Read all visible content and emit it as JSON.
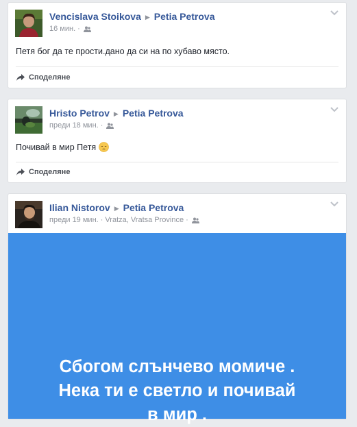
{
  "posts": [
    {
      "author": "Vencislava Stoikova",
      "target": "Petia Petrova",
      "time": "16 мин.",
      "location": "",
      "text": "Петя бог да те прости.дано да си на по хубаво място.",
      "share_label": "Споделяне"
    },
    {
      "author": "Hristo Petrov",
      "target": "Petia Petrova",
      "time": "преди 18 мин.",
      "location": "",
      "text": "Почивай в мир Петя",
      "share_label": "Споделяне"
    },
    {
      "author": "Ilian Nistorov",
      "target": "Petia Petrova",
      "time": "преди 19 мин.",
      "location": "Vratza, Vratsa Province",
      "image_text": [
        "Сбогом слънчево момиче .",
        "Нека ти е светло и почивай",
        "в мир ."
      ]
    }
  ],
  "colors": {
    "link": "#365899",
    "background": "#e9ebee",
    "image_background": "#3e8ee6"
  }
}
